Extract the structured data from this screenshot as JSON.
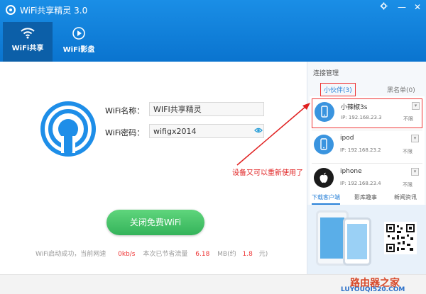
{
  "window": {
    "title": "WiFi共享精灵 3.0",
    "settings_icon": "gear-icon",
    "minimize_label": "—",
    "close_label": "✕"
  },
  "nav": {
    "tabs": [
      {
        "label": "WiFi共享",
        "icon": "wifi-icon",
        "active": true
      },
      {
        "label": "WiFi影盘",
        "icon": "play-icon",
        "active": false
      }
    ]
  },
  "main": {
    "wifi_name_label": "WiFi名称：",
    "wifi_name_value": "WIFI共享精灵",
    "wifi_password_label": "WiFi密码：",
    "wifi_password_value": "wifigx2014",
    "close_button_label": "关闭免费WiFi",
    "status": {
      "prefix": "WiFi启动成功，当前网速",
      "speed": "0kb/s",
      "saved_text": "本次已节省流量",
      "saved_value": "6.18",
      "unit_text": "MB(约",
      "money_value": "1.8",
      "money_unit": "元)"
    }
  },
  "side": {
    "title": "连接管理",
    "tabs": {
      "partners": "小伙伴(3)",
      "blacklist": "黑名单(0)"
    },
    "devices": [
      {
        "name": "小辣椒3s",
        "ip": "IP: 192.168.23.3",
        "limit": "不限",
        "icon": "phone-icon"
      },
      {
        "name": "ipod",
        "ip": "IP: 192.168.23.2",
        "limit": "不限",
        "icon": "phone-icon"
      },
      {
        "name": "iphone",
        "ip": "IP: 192.168.23.4",
        "limit": "不限",
        "icon": "apple-icon"
      }
    ],
    "info_tabs": [
      "下载客户端",
      "影库趣事",
      "新闻资讯"
    ]
  },
  "annotation": "设备又可以重新使用了",
  "watermark": {
    "cn": "路由器之家",
    "en": "LUYOUQI520.COM"
  },
  "colors": {
    "header_blue": "#0a74cf",
    "button_green": "#34b35a",
    "highlight_red": "#e33333"
  }
}
